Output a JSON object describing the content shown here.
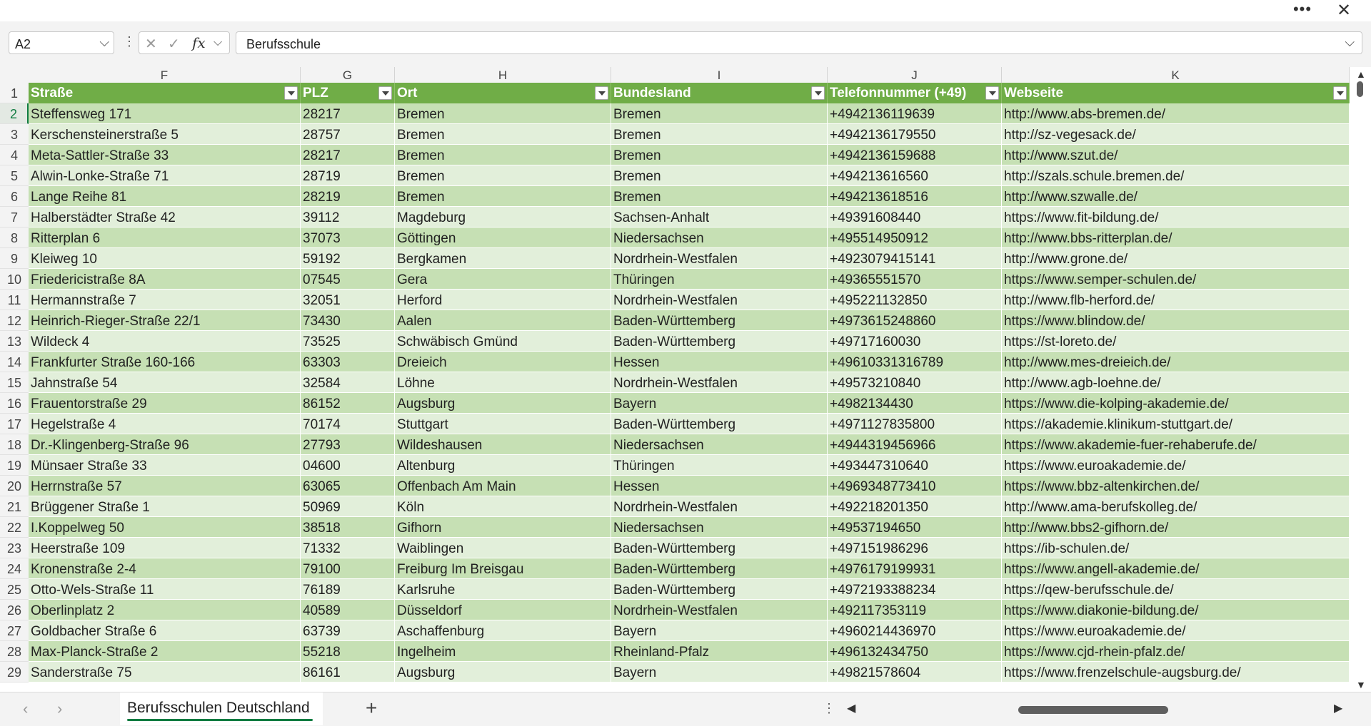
{
  "window": {
    "more_icon": "more-horizontal-icon",
    "close_icon": "close-icon"
  },
  "formula_bar": {
    "name_box": "A2",
    "formula_value": "Berufsschule"
  },
  "columns": [
    "F",
    "G",
    "H",
    "I",
    "J",
    "K"
  ],
  "header_row": {
    "number": "1",
    "cells": [
      "Straße",
      "PLZ",
      "Ort",
      "Bundesland",
      "Telefonnummer (+49)",
      "Webseite"
    ]
  },
  "rows": [
    {
      "n": "2",
      "c": [
        "Steffensweg 171",
        "28217",
        "Bremen",
        "Bremen",
        "+4942136119639",
        "http://www.abs-bremen.de/"
      ]
    },
    {
      "n": "3",
      "c": [
        "Kerschensteinerstraße 5",
        "28757",
        "Bremen",
        "Bremen",
        "+4942136179550",
        "http://sz-vegesack.de/"
      ]
    },
    {
      "n": "4",
      "c": [
        "Meta-Sattler-Straße 33",
        "28217",
        "Bremen",
        "Bremen",
        "+4942136159688",
        "http://www.szut.de/"
      ]
    },
    {
      "n": "5",
      "c": [
        "Alwin-Lonke-Straße 71",
        "28719",
        "Bremen",
        "Bremen",
        "+494213616560",
        "http://szals.schule.bremen.de/"
      ]
    },
    {
      "n": "6",
      "c": [
        "Lange Reihe 81",
        "28219",
        "Bremen",
        "Bremen",
        "+494213618516",
        "http://www.szwalle.de/"
      ]
    },
    {
      "n": "7",
      "c": [
        "Halberstädter Straße 42",
        "39112",
        "Magdeburg",
        "Sachsen-Anhalt",
        "+49391608440",
        "https://www.fit-bildung.de/"
      ]
    },
    {
      "n": "8",
      "c": [
        "Ritterplan 6",
        "37073",
        "Göttingen",
        "Niedersachsen",
        "+495514950912",
        "http://www.bbs-ritterplan.de/"
      ]
    },
    {
      "n": "9",
      "c": [
        "Kleiweg 10",
        "59192",
        "Bergkamen",
        "Nordrhein-Westfalen",
        "+4923079415141",
        "http://www.grone.de/"
      ]
    },
    {
      "n": "10",
      "c": [
        "Friedericistraße 8A",
        "07545",
        "Gera",
        "Thüringen",
        "+49365551570",
        "https://www.semper-schulen.de/"
      ]
    },
    {
      "n": "11",
      "c": [
        "Hermannstraße 7",
        "32051",
        "Herford",
        "Nordrhein-Westfalen",
        "+495221132850",
        "http://www.flb-herford.de/"
      ]
    },
    {
      "n": "12",
      "c": [
        "Heinrich-Rieger-Straße 22/1",
        "73430",
        "Aalen",
        "Baden-Württemberg",
        "+4973615248860",
        "https://www.blindow.de/"
      ]
    },
    {
      "n": "13",
      "c": [
        "Wildeck 4",
        "73525",
        "Schwäbisch Gmünd",
        "Baden-Württemberg",
        "+49717160030",
        "https://st-loreto.de/"
      ]
    },
    {
      "n": "14",
      "c": [
        "Frankfurter Straße 160-166",
        "63303",
        "Dreieich",
        "Hessen",
        "+49610331316789",
        "http://www.mes-dreieich.de/"
      ]
    },
    {
      "n": "15",
      "c": [
        "Jahnstraße 54",
        "32584",
        "Löhne",
        "Nordrhein-Westfalen",
        "+49573210840",
        "http://www.agb-loehne.de/"
      ]
    },
    {
      "n": "16",
      "c": [
        "Frauentorstraße 29",
        "86152",
        "Augsburg",
        "Bayern",
        "+4982134430",
        "https://www.die-kolping-akademie.de/"
      ]
    },
    {
      "n": "17",
      "c": [
        "Hegelstraße 4",
        "70174",
        "Stuttgart",
        "Baden-Württemberg",
        "+4971127835800",
        "https://akademie.klinikum-stuttgart.de/"
      ]
    },
    {
      "n": "18",
      "c": [
        "Dr.-Klingenberg-Straße 96",
        "27793",
        "Wildeshausen",
        "Niedersachsen",
        "+4944319456966",
        "https://www.akademie-fuer-rehaberufe.de/"
      ]
    },
    {
      "n": "19",
      "c": [
        "Münsaer Straße 33",
        "04600",
        "Altenburg",
        "Thüringen",
        "+493447310640",
        "https://www.euroakademie.de/"
      ]
    },
    {
      "n": "20",
      "c": [
        "Herrnstraße 57",
        "63065",
        "Offenbach Am Main",
        "Hessen",
        "+4969348773410",
        "https://www.bbz-altenkirchen.de/"
      ]
    },
    {
      "n": "21",
      "c": [
        "Brüggener Straße 1",
        "50969",
        "Köln",
        "Nordrhein-Westfalen",
        "+492218201350",
        "http://www.ama-berufskolleg.de/"
      ]
    },
    {
      "n": "22",
      "c": [
        "I.Koppelweg 50",
        "38518",
        "Gifhorn",
        "Niedersachsen",
        "+49537194650",
        "http://www.bbs2-gifhorn.de/"
      ]
    },
    {
      "n": "23",
      "c": [
        "Heerstraße 109",
        "71332",
        "Waiblingen",
        "Baden-Württemberg",
        "+497151986296",
        "https://ib-schulen.de/"
      ]
    },
    {
      "n": "24",
      "c": [
        "Kronenstraße 2-4",
        "79100",
        "Freiburg Im Breisgau",
        "Baden-Württemberg",
        "+4976179199931",
        "https://www.angell-akademie.de/"
      ]
    },
    {
      "n": "25",
      "c": [
        "Otto-Wels-Straße 11",
        "76189",
        "Karlsruhe",
        "Baden-Württemberg",
        "+4972193388234",
        "https://qew-berufsschule.de/"
      ]
    },
    {
      "n": "26",
      "c": [
        "Oberlinplatz 2",
        "40589",
        "Düsseldorf",
        "Nordrhein-Westfalen",
        "+492117353119",
        "https://www.diakonie-bildung.de/"
      ]
    },
    {
      "n": "27",
      "c": [
        "Goldbacher Straße 6",
        "63739",
        "Aschaffenburg",
        "Bayern",
        "+4960214436970",
        "https://www.euroakademie.de/"
      ]
    },
    {
      "n": "28",
      "c": [
        "Max-Planck-Straße 2",
        "55218",
        "Ingelheim",
        "Rheinland-Pfalz",
        "+496132434750",
        "https://www.cjd-rhein-pfalz.de/"
      ]
    },
    {
      "n": "29",
      "c": [
        "Sanderstraße 75",
        "86161",
        "Augsburg",
        "Bayern",
        "+49821578604",
        "https://www.frenzelschule-augsburg.de/"
      ]
    }
  ],
  "sheet_tab": {
    "label": "Berufsschulen Deutschland",
    "add_label": "+"
  },
  "colors": {
    "header_green": "#70ad47",
    "band_dark": "#c6e0b4",
    "band_light": "#e2efda",
    "accent": "#107c41"
  }
}
